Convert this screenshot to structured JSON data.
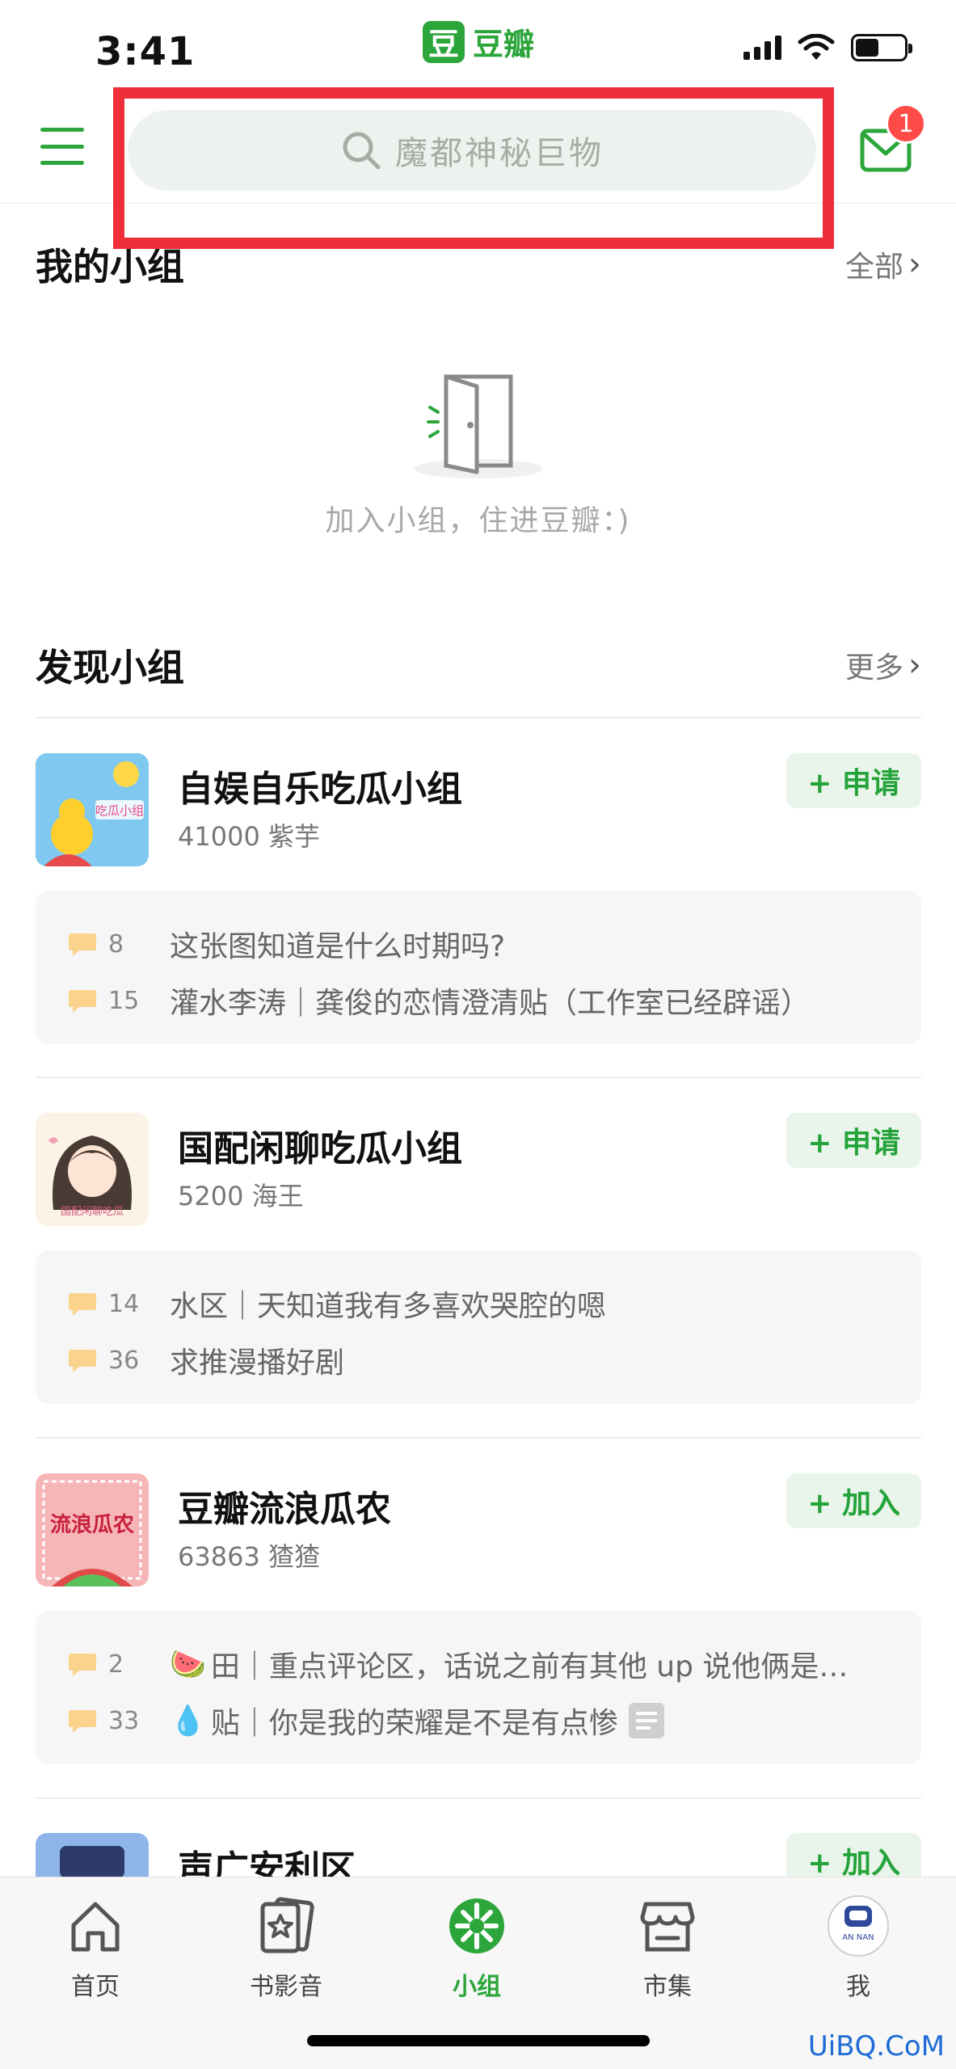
{
  "status_bar": {
    "time": "3:41",
    "app_logo": "豆",
    "app_name": "豆瓣"
  },
  "header": {
    "search_placeholder": "魔都神秘巨物",
    "mail_badge": "1"
  },
  "my_groups": {
    "title": "我的小组",
    "link": "全部",
    "empty_text": "加入小组，住进豆瓣：)"
  },
  "discover": {
    "title": "发现小组",
    "link": "更多",
    "groups": [
      {
        "name": "自娱自乐吃瓜小组",
        "meta": "41000 紫芋",
        "action": "+ 申请",
        "avatar_text": "吃瓜小组",
        "topics": [
          {
            "count": "8",
            "prefix": "",
            "title": "这张图知道是什么时期吗?"
          },
          {
            "count": "15",
            "prefix": "",
            "title": "灌水李涛｜龚俊的恋情澄清贴（工作室已经辟谣）"
          }
        ]
      },
      {
        "name": "国配闲聊吃瓜小组",
        "meta": "5200 海王",
        "action": "+ 申请",
        "avatar_text": "国配闲聊吃瓜",
        "topics": [
          {
            "count": "14",
            "prefix": "",
            "title": "水区｜天知道我有多喜欢哭腔的嗯"
          },
          {
            "count": "36",
            "prefix": "",
            "title": "求推漫播好剧"
          }
        ]
      },
      {
        "name": "豆瓣流浪瓜农",
        "meta": "63863 猹猹",
        "action": "+ 加入",
        "avatar_text": "流浪瓜农",
        "topics": [
          {
            "count": "2",
            "prefix": "🍉",
            "title": "田｜重点评论区，话说之前有其他 up 说他俩是…"
          },
          {
            "count": "33",
            "prefix": "💧",
            "title": "贴｜你是我的荣耀是不是有点惨"
          }
        ]
      },
      {
        "name": "声广安利区",
        "meta": "",
        "action": "+ 加入",
        "avatar_text": "",
        "topics": []
      }
    ]
  },
  "tabbar": {
    "tabs": [
      {
        "label": "首页",
        "icon": "home-icon"
      },
      {
        "label": "书影音",
        "icon": "star-cards-icon"
      },
      {
        "label": "小组",
        "icon": "group-icon",
        "active": true
      },
      {
        "label": "市集",
        "icon": "store-icon"
      },
      {
        "label": "我",
        "icon": "avatar-icon"
      }
    ],
    "avatar_text": "AN NAN"
  },
  "colors": {
    "brand_green": "#2ca63b",
    "highlight_red": "#ee2f3a",
    "badge_red": "#ff4b47"
  },
  "watermark": "UiBQ.CoM"
}
